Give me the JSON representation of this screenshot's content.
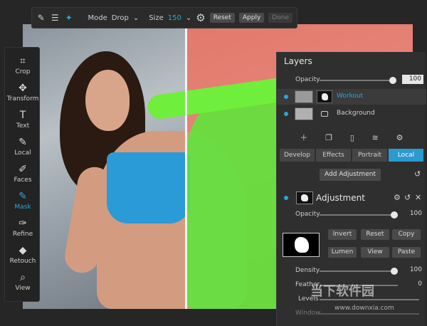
{
  "topbar": {
    "mode_label": "Mode",
    "mode_value": "Drop",
    "size_label": "Size",
    "size_value": "150",
    "reset": "Reset",
    "apply": "Apply",
    "done": "Done"
  },
  "tools": [
    {
      "label": "Crop",
      "icon": "crop-icon"
    },
    {
      "label": "Transform",
      "icon": "move-icon"
    },
    {
      "label": "Text",
      "icon": "text-icon"
    },
    {
      "label": "Local",
      "icon": "brush-icon"
    },
    {
      "label": "Faces",
      "icon": "face-icon"
    },
    {
      "label": "Mask",
      "icon": "mask-icon"
    },
    {
      "label": "Refine",
      "icon": "refine-icon"
    },
    {
      "label": "Retouch",
      "icon": "eraser-icon"
    },
    {
      "label": "View",
      "icon": "zoom-icon"
    }
  ],
  "layers": {
    "title": "Layers",
    "opacity_label": "Opacity",
    "opacity_value": "100",
    "items": [
      {
        "name": "Workout"
      },
      {
        "name": "Background"
      }
    ],
    "tabs": [
      "Develop",
      "Effects",
      "Portrait",
      "Local"
    ],
    "add_adjustment": "Add Adjustment",
    "adjustment": {
      "title": "Adjustment",
      "opacity_label": "Opacity",
      "opacity_value": "100",
      "buttons": [
        "Invert",
        "Reset",
        "Copy",
        "Lumen",
        "View",
        "Paste"
      ],
      "density_label": "Density",
      "density_value": "100",
      "feather_label": "Feather",
      "feather_value": "0",
      "levels_label": "Levels",
      "window_label": "Window"
    }
  },
  "watermark": {
    "text": "当下软件园",
    "url": "www.downxia.com"
  },
  "colors": {
    "accent": "#2aa7d6",
    "mask_overlay": "#e07a6c",
    "selection_green": "#5fe33c"
  }
}
